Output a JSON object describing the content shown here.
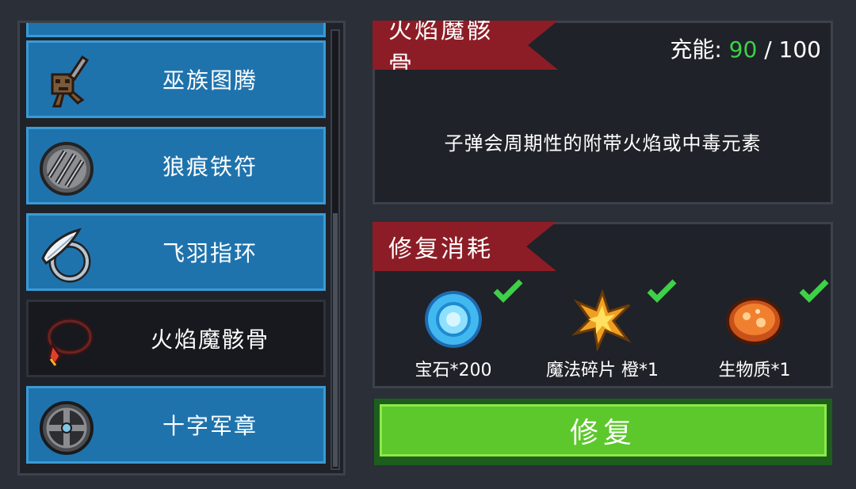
{
  "items": [
    {
      "name": "",
      "icon": "partial-item-icon"
    },
    {
      "name": "巫族图腾",
      "icon": "totem-icon"
    },
    {
      "name": "狼痕铁符",
      "icon": "wolf-claw-talisman-icon"
    },
    {
      "name": "飞羽指环",
      "icon": "feather-ring-icon"
    },
    {
      "name": "火焰魔骸骨",
      "icon": "fire-bone-necklace-icon"
    },
    {
      "name": "十字军章",
      "icon": "crusader-badge-icon"
    }
  ],
  "selected_index": 4,
  "detail": {
    "title": "火焰魔骸骨",
    "charge_label": "充能:",
    "charge_current": "90",
    "charge_sep": " / ",
    "charge_max": "100",
    "description": "子弹会周期性的附带火焰或中毒元素"
  },
  "repair_cost": {
    "title": "修复消耗",
    "items": [
      {
        "label": "宝石*200",
        "icon": "gem-icon",
        "satisfied": true
      },
      {
        "label": "魔法碎片 橙*1",
        "icon": "orange-magic-shard-icon",
        "satisfied": true
      },
      {
        "label": "生物质*1",
        "icon": "biomass-icon",
        "satisfied": true
      }
    ]
  },
  "repair_button": "修复",
  "colors": {
    "item_bg": "#1f73ad",
    "ribbon": "#8c1d26",
    "charge_value": "#3ed048",
    "button": "#5cc82c",
    "check": "#3ed048"
  }
}
